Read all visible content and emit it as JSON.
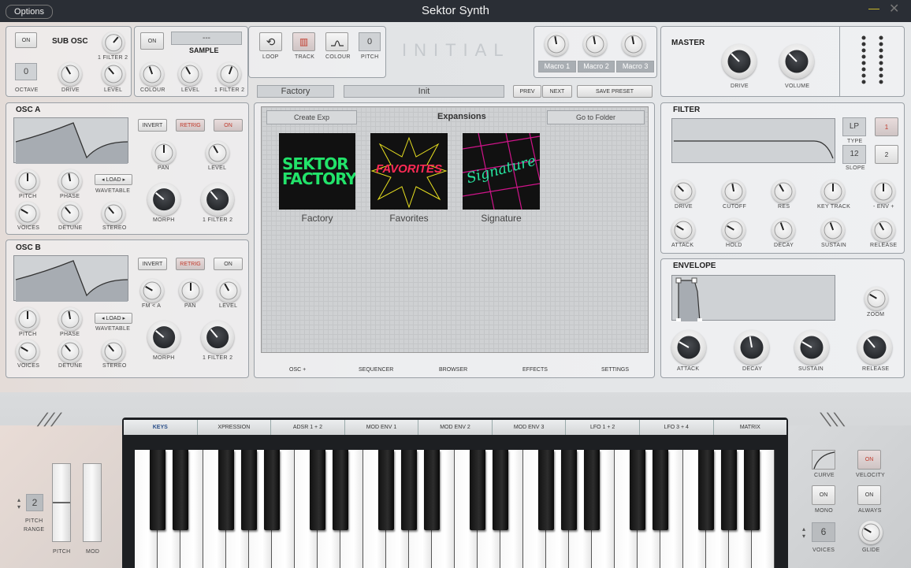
{
  "window": {
    "title": "Sektor Synth",
    "options_label": "Options"
  },
  "logo_text": "INITIAL",
  "sub_osc": {
    "on": "ON",
    "title": "SUB OSC",
    "filter_knob": "1 FILTER 2",
    "octave_value": "0",
    "octave": "OCTAVE",
    "drive": "DRIVE",
    "level": "LEVEL"
  },
  "sample": {
    "on": "ON",
    "name": "---",
    "title": "SAMPLE",
    "colour": "COLOUR",
    "level": "LEVEL",
    "filter": "1 FILTER 2"
  },
  "transport": {
    "loop": "LOOP",
    "track": "TRACK",
    "colour": "COLOUR",
    "pitch_value": "0",
    "pitch": "PITCH"
  },
  "macros": [
    "Macro 1",
    "Macro 2",
    "Macro 3"
  ],
  "master": {
    "title": "MASTER",
    "drive": "DRIVE",
    "volume": "VOLUME"
  },
  "osc_a": {
    "title": "OSC A",
    "invert": "INVERT",
    "retrig": "RETRIG",
    "on": "ON",
    "pan": "PAN",
    "level": "LEVEL",
    "pitch": "PITCH",
    "phase": "PHASE",
    "load": "LOAD",
    "wavetable": "WAVETABLE",
    "morph": "MORPH",
    "filter": "1 FILTER 2",
    "voices": "VOICES",
    "detune": "DETUNE",
    "stereo": "STEREO"
  },
  "osc_b": {
    "title": "OSC B",
    "invert": "INVERT",
    "retrig": "RETRIG",
    "on": "ON",
    "fm": "FM < A",
    "pan": "PAN",
    "level": "LEVEL",
    "pitch": "PITCH",
    "phase": "PHASE",
    "load": "LOAD",
    "wavetable": "WAVETABLE",
    "morph": "MORPH",
    "filter": "1 FILTER 2",
    "voices": "VOICES",
    "detune": "DETUNE",
    "stereo": "STEREO"
  },
  "preset": {
    "bank": "Factory",
    "name": "Init",
    "prev": "PREV",
    "next": "NEXT",
    "save": "SAVE PRESET"
  },
  "browser": {
    "create_exp": "Create Exp",
    "title": "Expansions",
    "go_folder": "Go to Folder",
    "expansions": [
      {
        "art": "SEKTOR FACTORY",
        "label": "Factory"
      },
      {
        "art": "FAVORITES",
        "label": "Favorites"
      },
      {
        "art": "Signature",
        "label": "Signature"
      }
    ]
  },
  "center_nav": [
    "OSC +",
    "SEQUENCER",
    "BROWSER",
    "EFFECTS",
    "SETTINGS"
  ],
  "filter": {
    "title": "FILTER",
    "type_value": "LP",
    "type": "TYPE",
    "slope_value": "12",
    "slope": "SLOPE",
    "btn1": "1",
    "btn2": "2",
    "drive": "DRIVE",
    "cutoff": "CUTOFF",
    "res": "RES",
    "key_track": "KEY TRACK",
    "env": "- ENV +",
    "attack": "ATTACK",
    "hold": "HOLD",
    "decay": "DECAY",
    "sustain": "SUSTAIN",
    "release": "RELEASE"
  },
  "envelope": {
    "title": "ENVELOPE",
    "zoom": "ZOOM",
    "attack": "ATTACK",
    "decay": "DECAY",
    "sustain": "SUSTAIN",
    "release": "RELEASE"
  },
  "tabs": [
    "KEYS",
    "XPRESSION",
    "ADSR 1 + 2",
    "MOD ENV 1",
    "MOD ENV 2",
    "MOD ENV 3",
    "LFO 1 + 2",
    "LFO 3 + 4",
    "MATRIX"
  ],
  "left_perf": {
    "range_value": "2",
    "range": "PITCH\nRANGE",
    "pitch": "PITCH",
    "mod": "MOD"
  },
  "right_perf": {
    "curve": "CURVE",
    "velocity_on": "ON",
    "velocity": "VELOCITY",
    "mono_on": "ON",
    "mono": "MONO",
    "always_on": "ON",
    "always": "ALWAYS",
    "voices_value": "6",
    "voices": "VOICES",
    "glide": "GLIDE"
  },
  "colors": {
    "accent_red": "#c0392b",
    "panel": "#e5e7e9",
    "dark": "#2a2e35"
  }
}
